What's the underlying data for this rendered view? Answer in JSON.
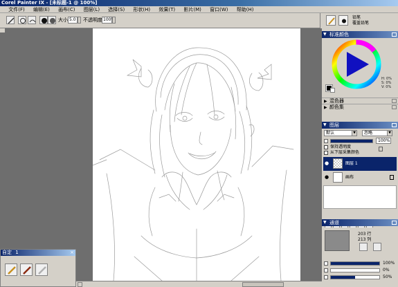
{
  "window": {
    "title": "Corel Painter IX - [未标题-1 @ 100%]"
  },
  "menu": [
    "文件(F)",
    "编辑(E)",
    "画布(C)",
    "图层(L)",
    "选择(S)",
    "形状(H)",
    "效果(T)",
    "影片(M)",
    "窗口(W)",
    "帮助(H)"
  ],
  "toolbar": {
    "size_label": "大小:",
    "size_value": "5.0",
    "opacity_label": "不透明度:",
    "opacity_value": "100%"
  },
  "brush": {
    "category": "铅笔",
    "variant": "覆盖铅笔"
  },
  "custom_palette": {
    "title": "自定",
    "number": "1",
    "close": "×"
  },
  "color_panel": {
    "title": "标准颜色",
    "hsv": {
      "h": "H: 0%",
      "s": "S: 0%",
      "v": "V: 0%"
    }
  },
  "mixer_panel": {
    "title": "混色器"
  },
  "color_set_panel": {
    "title": "颜色集"
  },
  "layers_panel": {
    "title": "图层",
    "composite_method": "默认",
    "composite_depth": "忽略",
    "opacity": "100%",
    "preserve_transparency": "保持透明度",
    "pick_up_underlying": "从下层采集颜色",
    "layers": [
      {
        "name": "图层 1",
        "active": true
      },
      {
        "name": "画布",
        "active": false
      }
    ]
  },
  "channels_panel": {
    "title": "通道",
    "rows": "203 行",
    "cols": "213 列",
    "sliders": [
      {
        "value": "100%",
        "fraction": 1.0
      },
      {
        "value": "0%",
        "fraction": 0.0
      },
      {
        "value": "50%",
        "fraction": 0.5
      }
    ]
  },
  "colors": {
    "title_blue": "#0a246a",
    "panel_gray": "#d4d0c8",
    "workspace": "#6e6e6e"
  }
}
